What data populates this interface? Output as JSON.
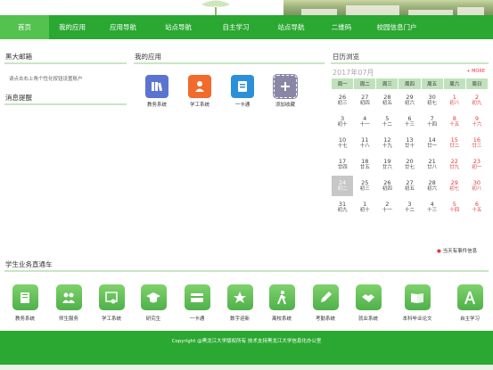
{
  "nav": {
    "items": [
      "首页",
      "我的应用",
      "应用导航",
      "站点导航",
      "自主学习",
      "站点导航",
      "二维码",
      "校园信息门户"
    ],
    "active_index": 0
  },
  "mail": {
    "title": "黑大邮箱",
    "text": "请点击右上角个性化按钮设置账户"
  },
  "notice": {
    "title": "消息提醒"
  },
  "myapps": {
    "title": "我的应用",
    "items": [
      {
        "label": "教务系统",
        "icon": "books-icon",
        "color": "#5b74d2"
      },
      {
        "label": "学工系统",
        "icon": "person-icon",
        "color": "#f26a2c"
      },
      {
        "label": "一卡通",
        "icon": "card-icon",
        "color": "#2b8fd9"
      },
      {
        "label": "添加收藏",
        "icon": "add-icon",
        "color": "#8a87a6"
      }
    ]
  },
  "calendar": {
    "title": "日历浏览",
    "month": "2017年07月",
    "more": "+ MORE",
    "weekdays": [
      "周一",
      "周二",
      "周三",
      "周四",
      "周五",
      "周六",
      "周日"
    ],
    "weeks": [
      [
        [
          "26",
          "初三"
        ],
        [
          "27",
          "初四"
        ],
        [
          "28",
          "初五"
        ],
        [
          "29",
          "初六"
        ],
        [
          "30",
          "初七"
        ],
        [
          "1",
          "初八"
        ],
        [
          "2",
          "初九"
        ]
      ],
      [
        [
          "3",
          "初十"
        ],
        [
          "4",
          "十一"
        ],
        [
          "5",
          "十二"
        ],
        [
          "6",
          "十三"
        ],
        [
          "7",
          "十四"
        ],
        [
          "8",
          "十五"
        ],
        [
          "9",
          "十六"
        ]
      ],
      [
        [
          "10",
          "十七"
        ],
        [
          "11",
          "十八"
        ],
        [
          "12",
          "十九"
        ],
        [
          "13",
          "廿十"
        ],
        [
          "14",
          "廿一"
        ],
        [
          "15",
          "廿二"
        ],
        [
          "16",
          "廿三"
        ]
      ],
      [
        [
          "17",
          "廿四"
        ],
        [
          "18",
          "廿五"
        ],
        [
          "19",
          "廿六"
        ],
        [
          "20",
          "廿七"
        ],
        [
          "21",
          "廿八"
        ],
        [
          "22",
          "廿九"
        ],
        [
          "23",
          "初一"
        ]
      ],
      [
        [
          "24",
          "初二"
        ],
        [
          "25",
          "初三"
        ],
        [
          "26",
          "初四"
        ],
        [
          "27",
          "初五"
        ],
        [
          "28",
          "初六"
        ],
        [
          "29",
          "初七"
        ],
        [
          "30",
          "初八"
        ]
      ],
      [
        [
          "31",
          "初九"
        ],
        [
          "1",
          "初十"
        ],
        [
          "2",
          "十一"
        ],
        [
          "3",
          "十二"
        ],
        [
          "4",
          "十三"
        ],
        [
          "5",
          "十四"
        ],
        [
          "6",
          "十五"
        ]
      ]
    ],
    "today": "24",
    "events_text": "当天有事件信息"
  },
  "services": {
    "title": "学生业务直通车",
    "items": [
      {
        "label": "教务系统",
        "icon": "book-icon"
      },
      {
        "label": "师生服务",
        "icon": "users-icon"
      },
      {
        "label": "学工系统",
        "icon": "certificate-icon"
      },
      {
        "label": "研究生",
        "icon": "graduation-cap-icon"
      },
      {
        "label": "一卡通",
        "icon": "card-icon"
      },
      {
        "label": "数字迎新",
        "icon": "gift-icon"
      },
      {
        "label": "离校系统",
        "icon": "walking-icon"
      },
      {
        "label": "考勤系统",
        "icon": "pencil-icon"
      },
      {
        "label": "就业系统",
        "icon": "handshake-icon"
      },
      {
        "label": "本科毕业论文",
        "icon": "open-book-icon"
      },
      {
        "label": "自主学习",
        "icon": "compass-icon"
      }
    ]
  },
  "footer": {
    "text": "Copyright @黑龙江大学版权所有  技术支持黑龙江大学信息化办公室"
  }
}
